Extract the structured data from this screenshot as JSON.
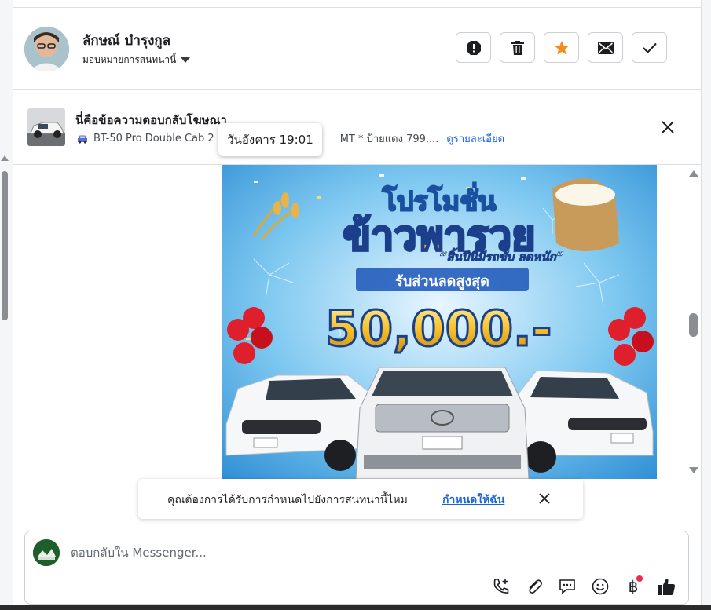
{
  "header": {
    "contact_name": "ลักษณ์ บำรุงกูล",
    "assign_label": "มอบหมายการสนทนานี้",
    "actions": [
      {
        "name": "report-spam-button",
        "icon": "alert-octagon-icon"
      },
      {
        "name": "delete-button",
        "icon": "trash-icon"
      },
      {
        "name": "star-button",
        "icon": "star-icon",
        "color": "#f28c1a"
      },
      {
        "name": "mark-unread-button",
        "icon": "envelope-icon"
      },
      {
        "name": "mark-done-button",
        "icon": "check-icon"
      }
    ]
  },
  "ad_reply": {
    "title": "นี่คือข้อความตอบกลับโฆษณา",
    "detail": "BT-50 Pro Double Cab 2",
    "detail_tail": "MT * ป้ายแดง 799,...",
    "link": "ดูรายละเอียด",
    "icon": "car-icon"
  },
  "tooltip": {
    "text": "วันอังคาร 19:01"
  },
  "banner": {
    "headline_1": "โปรโมชั่น",
    "headline_2": "ข้าวพารวย",
    "tagline": "“สิ้นปีนี้มีรถขับ ลดหนัก”",
    "discount_label": "รับส่วนลดสูงสุด",
    "amount": "50,000.-"
  },
  "assign_prompt": {
    "text": "คุณต้องการได้รับการกำหนดไปยังการสนทนานี้ไหม",
    "link": "กำหนดให้ฉัน"
  },
  "composer": {
    "placeholder": "ตอบกลับใน Messenger...",
    "baht_symbol": "฿",
    "tools": [
      "call-add-icon",
      "paperclip-icon",
      "chat-bubble-icon",
      "emoji-icon",
      "baht-icon",
      "thumbs-up-icon"
    ],
    "accent": "#f0284a"
  }
}
